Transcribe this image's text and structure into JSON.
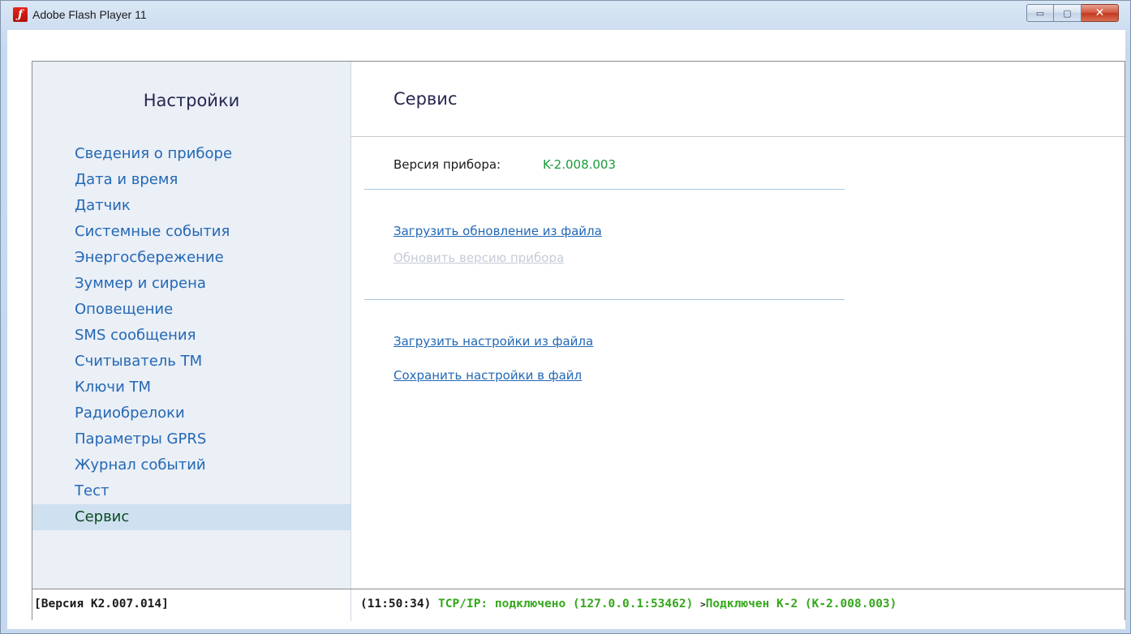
{
  "window": {
    "title": "Adobe Flash Player 11",
    "icon": "flash-logo-icon",
    "controls": {
      "minimize": "▭",
      "maximize": "▢",
      "close": "✕"
    }
  },
  "sidebar": {
    "title": "Настройки",
    "items": [
      {
        "label": "Сведения о приборе"
      },
      {
        "label": "Дата и время"
      },
      {
        "label": "Датчик"
      },
      {
        "label": "Системные события"
      },
      {
        "label": "Энергосбережение"
      },
      {
        "label": "Зуммер и сирена"
      },
      {
        "label": "Оповещение"
      },
      {
        "label": "SMS сообщения"
      },
      {
        "label": "Считыватель ТМ"
      },
      {
        "label": "Ключи ТМ"
      },
      {
        "label": "Радиобрелоки"
      },
      {
        "label": "Параметры GPRS"
      },
      {
        "label": "Журнал событий"
      },
      {
        "label": "Тест"
      },
      {
        "label": "Сервис"
      }
    ],
    "active_index": 14
  },
  "main": {
    "title": "Сервис",
    "version_label": "Версия прибора:",
    "version_value": "K-2.008.003",
    "links": {
      "upload_update": "Загрузить обновление из файла",
      "update_device": "Обновить версию прибора",
      "load_settings": "Загрузить настройки из файла",
      "save_settings": "Сохранить настройки в файл"
    }
  },
  "status": {
    "app_version": "[Версия K2.007.014]",
    "time": "(11:50:34)",
    "connection": "TCP/IP: подключено (127.0.0.1:53462)",
    "arrow": ">",
    "device": "Подключен K-2 (K-2.008.003)"
  },
  "colors": {
    "link": "#2368b5",
    "active_item_bg": "#cfe0f1",
    "status_green": "#35a71c",
    "version_green": "#1a9a3a"
  }
}
